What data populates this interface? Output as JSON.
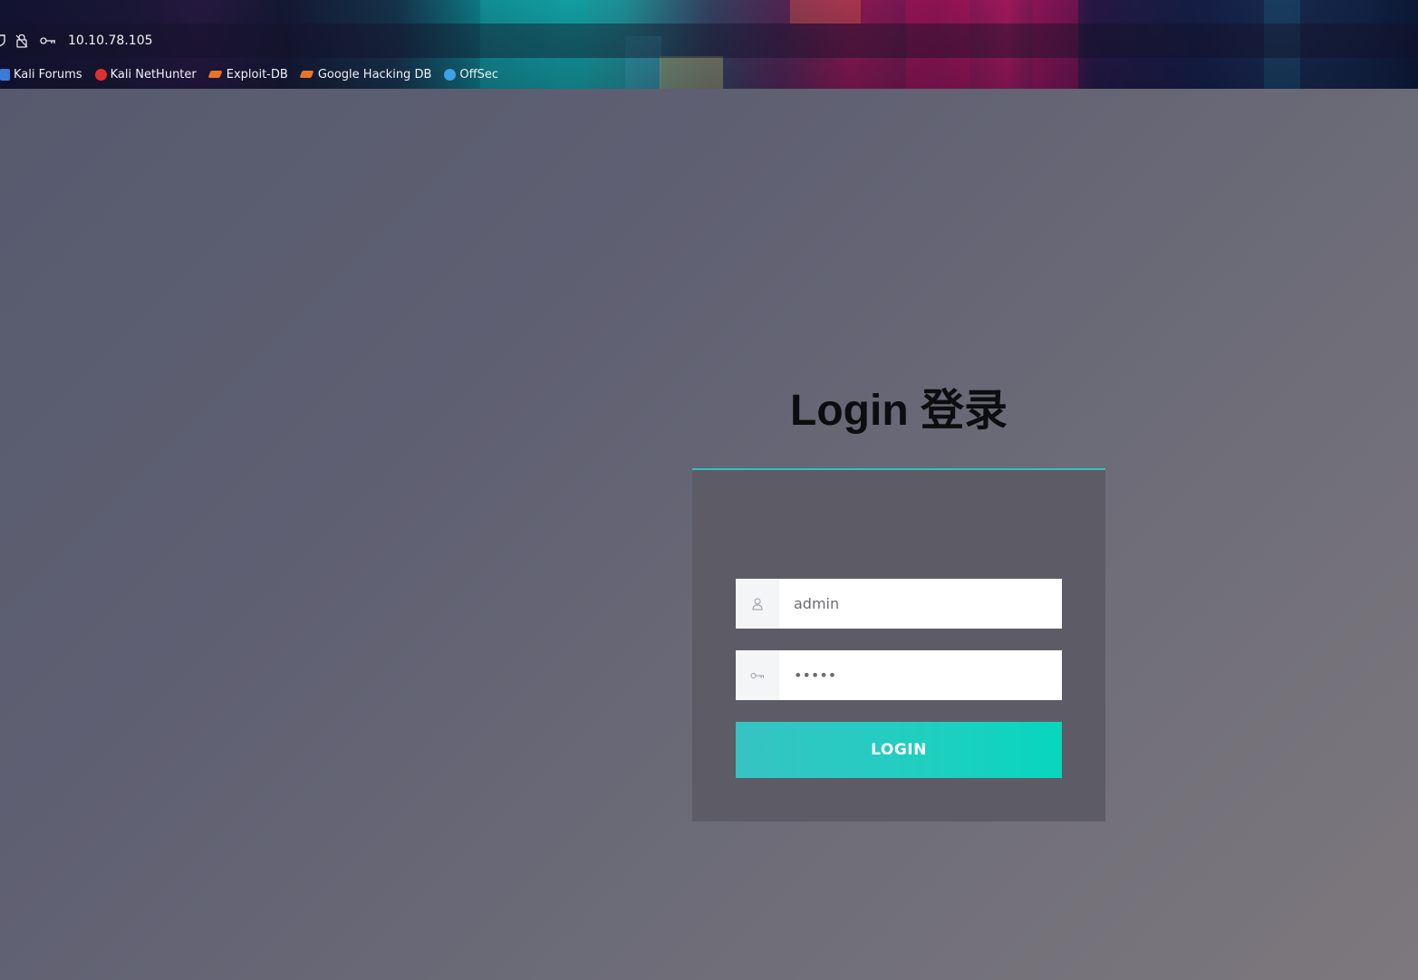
{
  "browser": {
    "url": "10.10.78.105",
    "icons": {
      "left": "shield-icon",
      "lock": "lock-strike-icon",
      "key": "key-icon"
    },
    "bookmarks": [
      {
        "label": "Kali Forums",
        "icon": "kali-forums-icon",
        "color": "#3b7bd8"
      },
      {
        "label": "Kali NetHunter",
        "icon": "kali-nethunter-icon",
        "color": "#e0312f"
      },
      {
        "label": "Exploit-DB",
        "icon": "exploit-db-icon",
        "color": "#e8742a"
      },
      {
        "label": "Google Hacking DB",
        "icon": "google-hacking-db-icon",
        "color": "#e8742a"
      },
      {
        "label": "OffSec",
        "icon": "offsec-icon",
        "color": "#3fa0e8"
      }
    ]
  },
  "login": {
    "title": "Login 登录",
    "username": {
      "value": "admin",
      "icon": "user-icon"
    },
    "password": {
      "value": "•••••",
      "icon": "key-icon"
    },
    "button_label": "LOGIN",
    "accent_color": "#2fc4b8"
  }
}
